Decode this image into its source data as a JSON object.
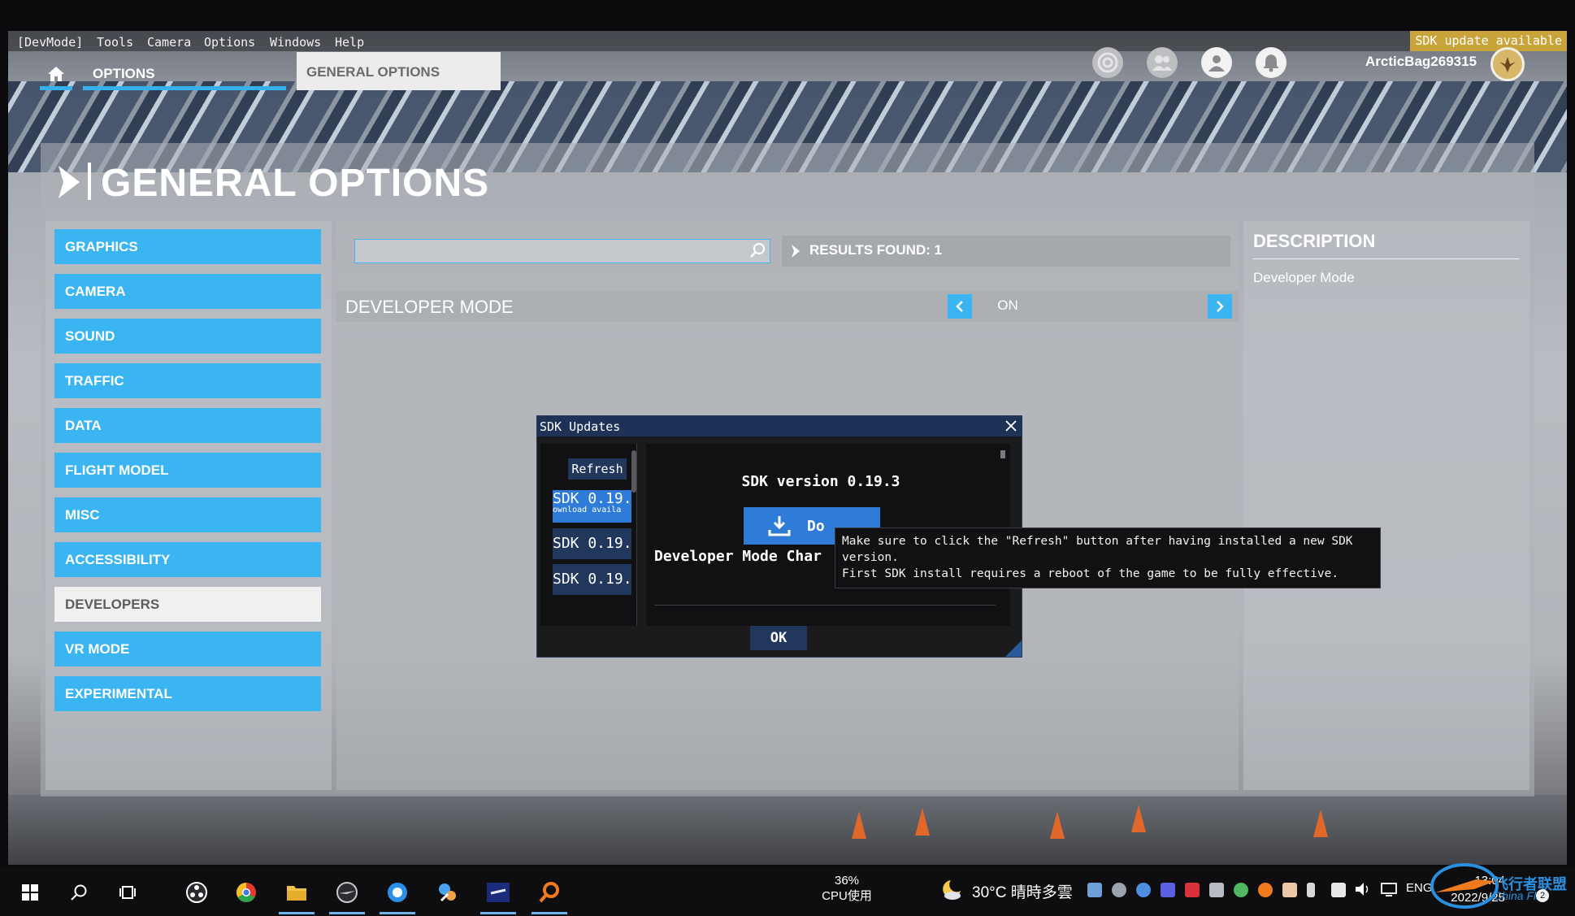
{
  "menubar": {
    "items": [
      "[DevMode]",
      "Tools",
      "Camera",
      "Options",
      "Windows",
      "Help"
    ],
    "sdk_flag": "SDK update available"
  },
  "topnav": {
    "options_label": "OPTIONS",
    "general_label": "GENERAL OPTIONS",
    "username": "ArcticBag269315"
  },
  "page": {
    "title": "GENERAL OPTIONS"
  },
  "sidebar": {
    "items": [
      {
        "label": "GRAPHICS"
      },
      {
        "label": "CAMERA"
      },
      {
        "label": "SOUND"
      },
      {
        "label": "TRAFFIC"
      },
      {
        "label": "DATA"
      },
      {
        "label": "FLIGHT MODEL"
      },
      {
        "label": "MISC"
      },
      {
        "label": "ACCESSIBILITY"
      },
      {
        "label": "DEVELOPERS"
      },
      {
        "label": "VR MODE"
      },
      {
        "label": "EXPERIMENTAL"
      }
    ],
    "active": "DEVELOPERS"
  },
  "search": {
    "placeholder": "SEARCH",
    "results": "RESULTS FOUND: 1"
  },
  "option": {
    "label": "DEVELOPER MODE",
    "value": "ON"
  },
  "description": {
    "title": "DESCRIPTION",
    "text": "Developer Mode"
  },
  "dialog": {
    "title": "SDK Updates",
    "refresh": "Refresh",
    "list": [
      {
        "label": "SDK 0.19.",
        "sub": "ownload availa"
      },
      {
        "label": "SDK 0.19.",
        "sub": ""
      },
      {
        "label": "SDK 0.19.",
        "sub": ""
      }
    ],
    "version": "SDK version 0.19.3",
    "download": "Do",
    "changelog": "Developer Mode Char",
    "ok": "OK",
    "tooltip_lines": [
      "Make sure to click the \"Refresh\" button after having installed a new SDK",
      "version.",
      "First SDK install requires a reboot of the game to be fully effective."
    ]
  },
  "taskbar": {
    "cpu_percent": "36%",
    "cpu_label": "CPU使用",
    "weather": "30°C 晴時多雲",
    "lang": "ENG",
    "time": "13:04",
    "date": "2022/9/25",
    "watermark": "飞行者联盟",
    "watermark_sub": "China Flier",
    "badge": "2"
  }
}
